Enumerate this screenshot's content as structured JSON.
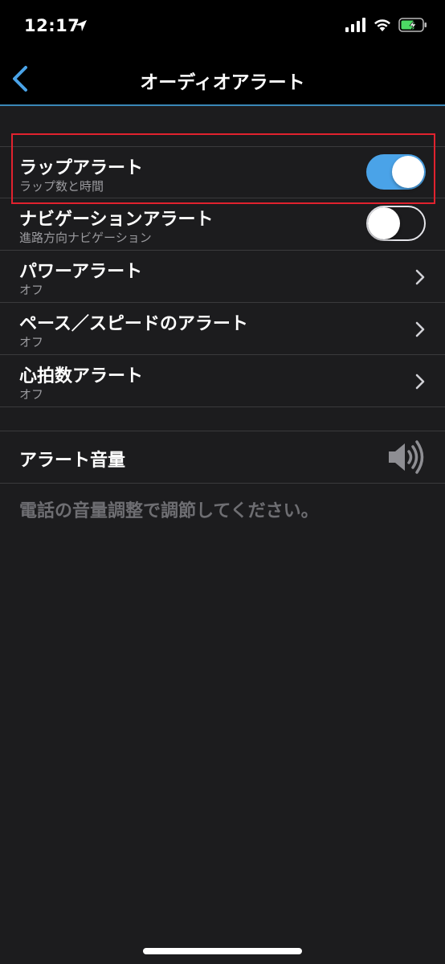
{
  "status_bar": {
    "time": "12:17"
  },
  "nav": {
    "title": "オーディオアラート"
  },
  "rows": [
    {
      "title": "ラップアラート",
      "subtitle": "ラップ数と時間",
      "toggle": true
    },
    {
      "title": "ナビゲーションアラート",
      "subtitle": "進路方向ナビゲーション",
      "toggle": false
    },
    {
      "title": "パワーアラート",
      "subtitle": "オフ"
    },
    {
      "title": "ペース／スピードのアラート",
      "subtitle": "オフ"
    },
    {
      "title": "心拍数アラート",
      "subtitle": "オフ"
    }
  ],
  "volume": {
    "title": "アラート音量",
    "note": "電話の音量調整で調節してください。"
  },
  "colors": {
    "accent": "#4aa3e8",
    "highlight": "#e1222e",
    "background": "#1c1c1e"
  },
  "icons": [
    "back-chevron-icon",
    "location-arrow-icon",
    "signal-icon",
    "wifi-icon",
    "battery-icon",
    "chevron-right-icon",
    "speaker-icon"
  ]
}
